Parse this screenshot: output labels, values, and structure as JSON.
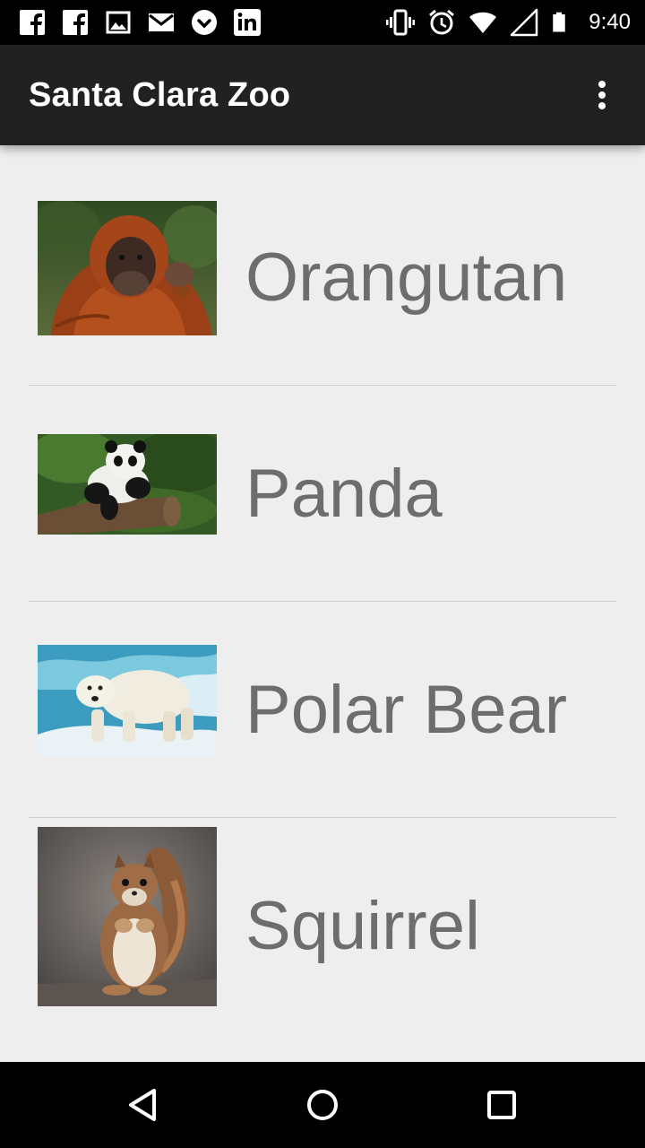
{
  "status_bar": {
    "time": "9:40",
    "left_icons": [
      "facebook-icon",
      "facebook-icon",
      "image-icon",
      "gmail-icon",
      "pocket-icon",
      "linkedin-icon"
    ],
    "right_icons": [
      "vibrate-icon",
      "alarm-icon",
      "wifi-icon",
      "signal-icon",
      "battery-icon"
    ]
  },
  "app_bar": {
    "title": "Santa Clara Zoo",
    "overflow_icon": "more-vert-icon"
  },
  "animals": [
    {
      "name": "Orangutan"
    },
    {
      "name": "Panda"
    },
    {
      "name": "Polar Bear"
    },
    {
      "name": "Squirrel"
    }
  ],
  "nav_bar": {
    "icons": [
      "back-icon",
      "home-icon",
      "recents-icon"
    ]
  }
}
